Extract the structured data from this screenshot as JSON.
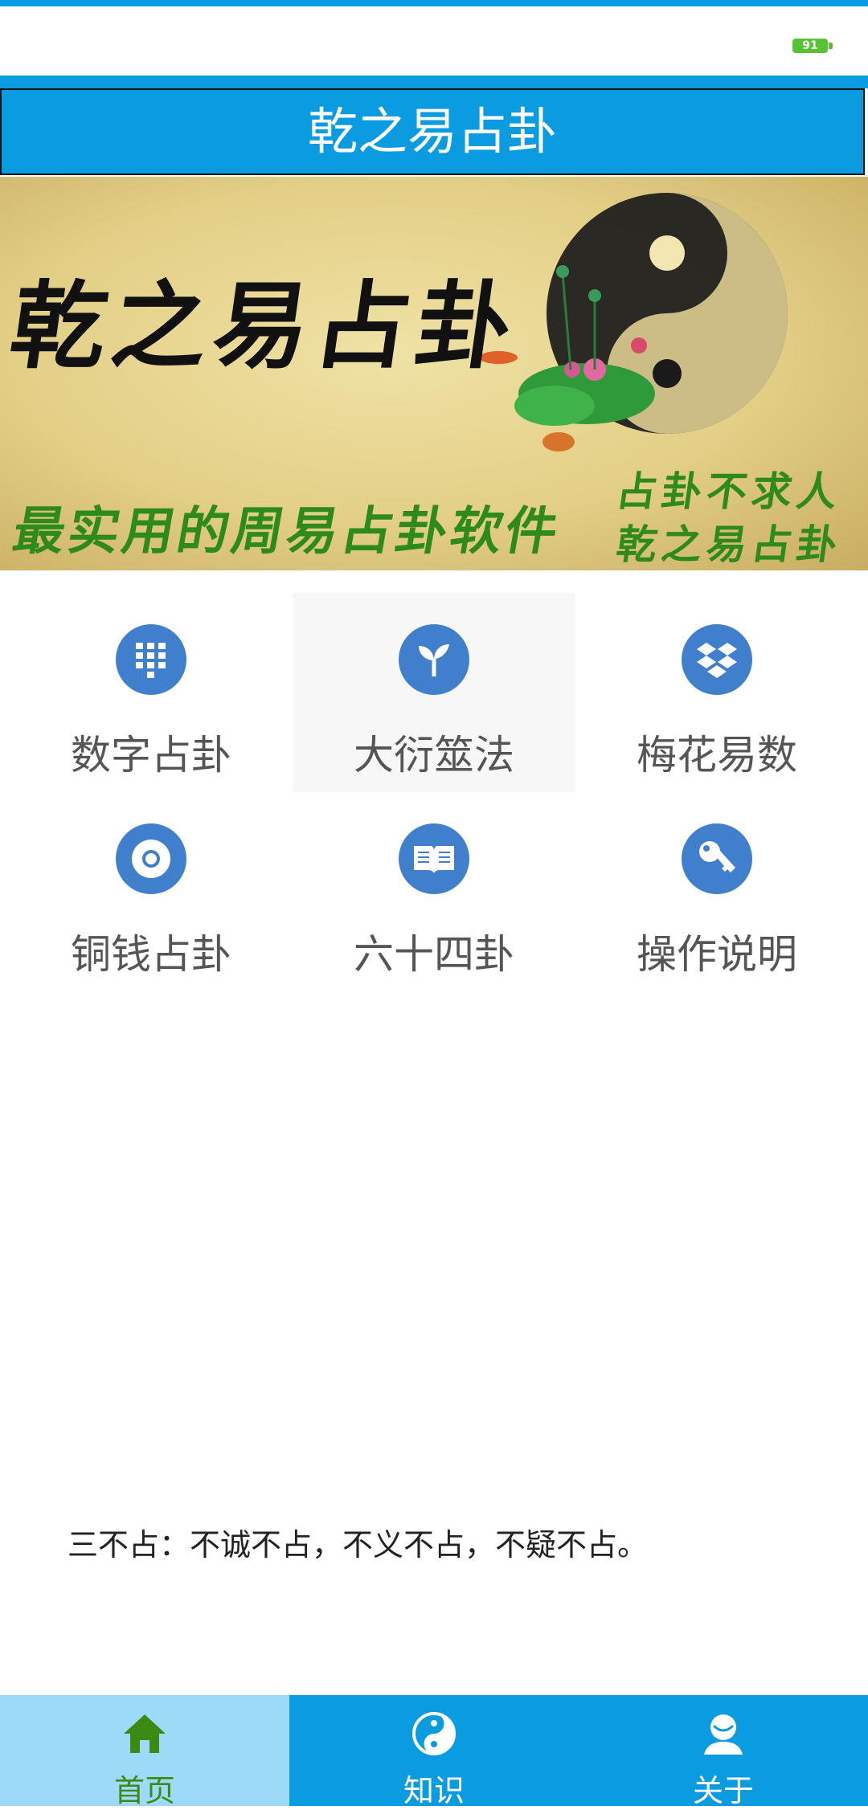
{
  "status_bar": {
    "battery": "91"
  },
  "header": {
    "title": "乾之易占卦"
  },
  "banner": {
    "title": "乾之易占卦",
    "subtitle": "最实用的周易占卦软件",
    "side_line1": "占卦不求人",
    "side_line2": "乾之易占卦"
  },
  "menu": {
    "items": [
      {
        "label": "数字占卦",
        "icon": "keypad-icon"
      },
      {
        "label": "大衍筮法",
        "icon": "sprout-icon"
      },
      {
        "label": "梅花易数",
        "icon": "dropbox-icon"
      },
      {
        "label": "铜钱占卦",
        "icon": "coin-icon"
      },
      {
        "label": "六十四卦",
        "icon": "book-icon"
      },
      {
        "label": "操作说明",
        "icon": "key-icon"
      }
    ]
  },
  "quote": "三不占：不诚不占，不义不占，不疑不占。",
  "tabbar": {
    "items": [
      {
        "label": "首页",
        "icon": "home-icon",
        "active": true
      },
      {
        "label": "知识",
        "icon": "yinyang-icon",
        "active": false
      },
      {
        "label": "关于",
        "icon": "user-icon",
        "active": false
      }
    ]
  },
  "colors": {
    "primary_blue": "#0a9be0",
    "icon_blue": "#3f7fcc",
    "active_tab": "#9ddaf8",
    "active_tab_text": "#3a8a13",
    "banner_green_text": "#2f8a1c"
  }
}
